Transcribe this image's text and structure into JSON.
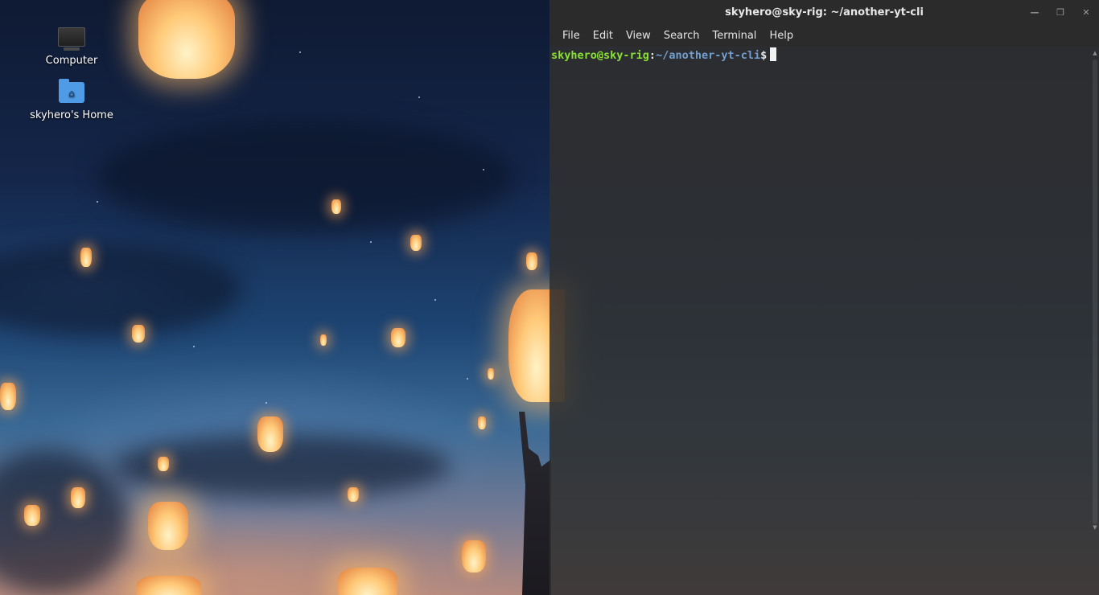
{
  "desktop": {
    "icons": [
      {
        "label": "Computer",
        "icon": "monitor-icon"
      },
      {
        "label": "skyhero's Home",
        "icon": "home-folder-icon"
      }
    ],
    "wallpaper": "night-sky-lanterns"
  },
  "terminal": {
    "title": "skyhero@sky-rig: ~/another-yt-cli",
    "window_controls": [
      "minimize",
      "maximize",
      "close"
    ],
    "menu": [
      "File",
      "Edit",
      "View",
      "Search",
      "Terminal",
      "Help"
    ],
    "prompt": {
      "user_host": "skyhero@sky-rig",
      "colon": ":",
      "path": "~/another-yt-cli",
      "dollar": "$"
    },
    "colors": {
      "user_host": "#8ae234",
      "path": "#729fcf",
      "background": "#303030",
      "titlebar": "#2b2b2b"
    }
  }
}
